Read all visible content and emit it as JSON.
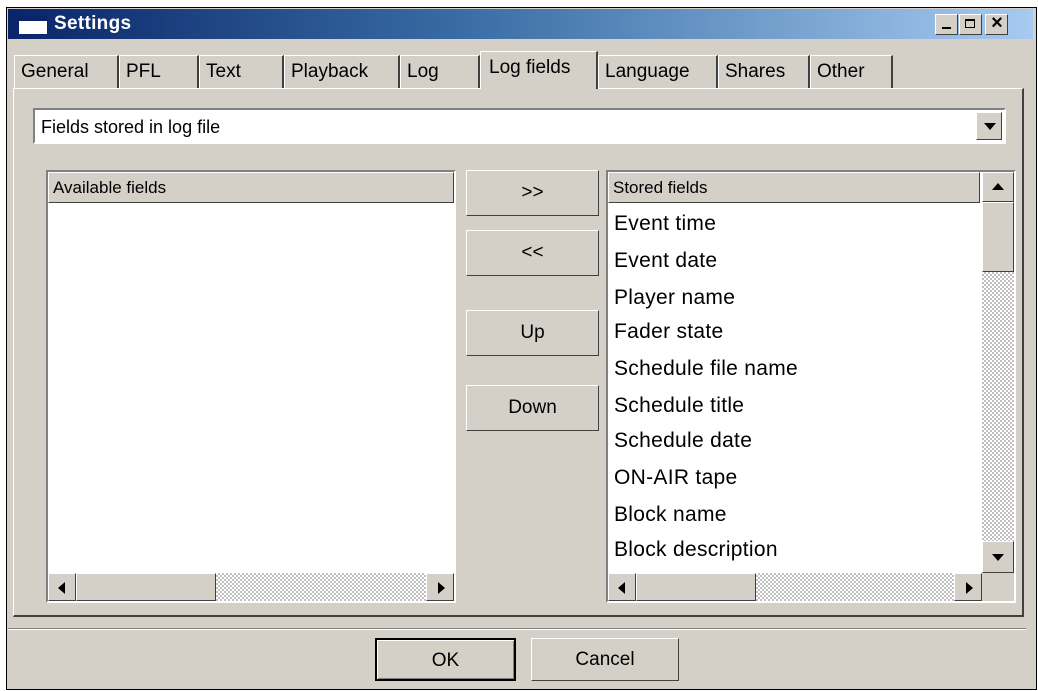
{
  "window": {
    "title": "Settings"
  },
  "caption_buttons": {
    "minimize": "minimize",
    "maximize": "maximize",
    "close": "×"
  },
  "tabs": [
    "General",
    "PFL",
    "Text",
    "Playback",
    "Log",
    "Log fields",
    "Language",
    "Shares",
    "Other"
  ],
  "active_tab": "Log fields",
  "selector": {
    "value": "Fields stored in log file"
  },
  "available": {
    "header": "Available fields",
    "items": []
  },
  "stored": {
    "header": "Stored fields",
    "items": [
      "Event time",
      "Event date",
      "Player name",
      "Fader state",
      "Schedule file name",
      "Schedule title",
      "Schedule date",
      "ON-AIR tape",
      "Block name",
      "Block description"
    ]
  },
  "buttons": {
    "add": ">>",
    "remove": "<<",
    "up": "Up",
    "down": "Down"
  },
  "footer": {
    "ok": "OK",
    "cancel": "Cancel"
  },
  "icons": {
    "window": "window-icon",
    "dropdown": "chevron-down-icon",
    "left": "arrow-left-icon",
    "right": "arrow-right-icon",
    "up": "arrow-up-icon",
    "down": "arrow-down-icon"
  }
}
